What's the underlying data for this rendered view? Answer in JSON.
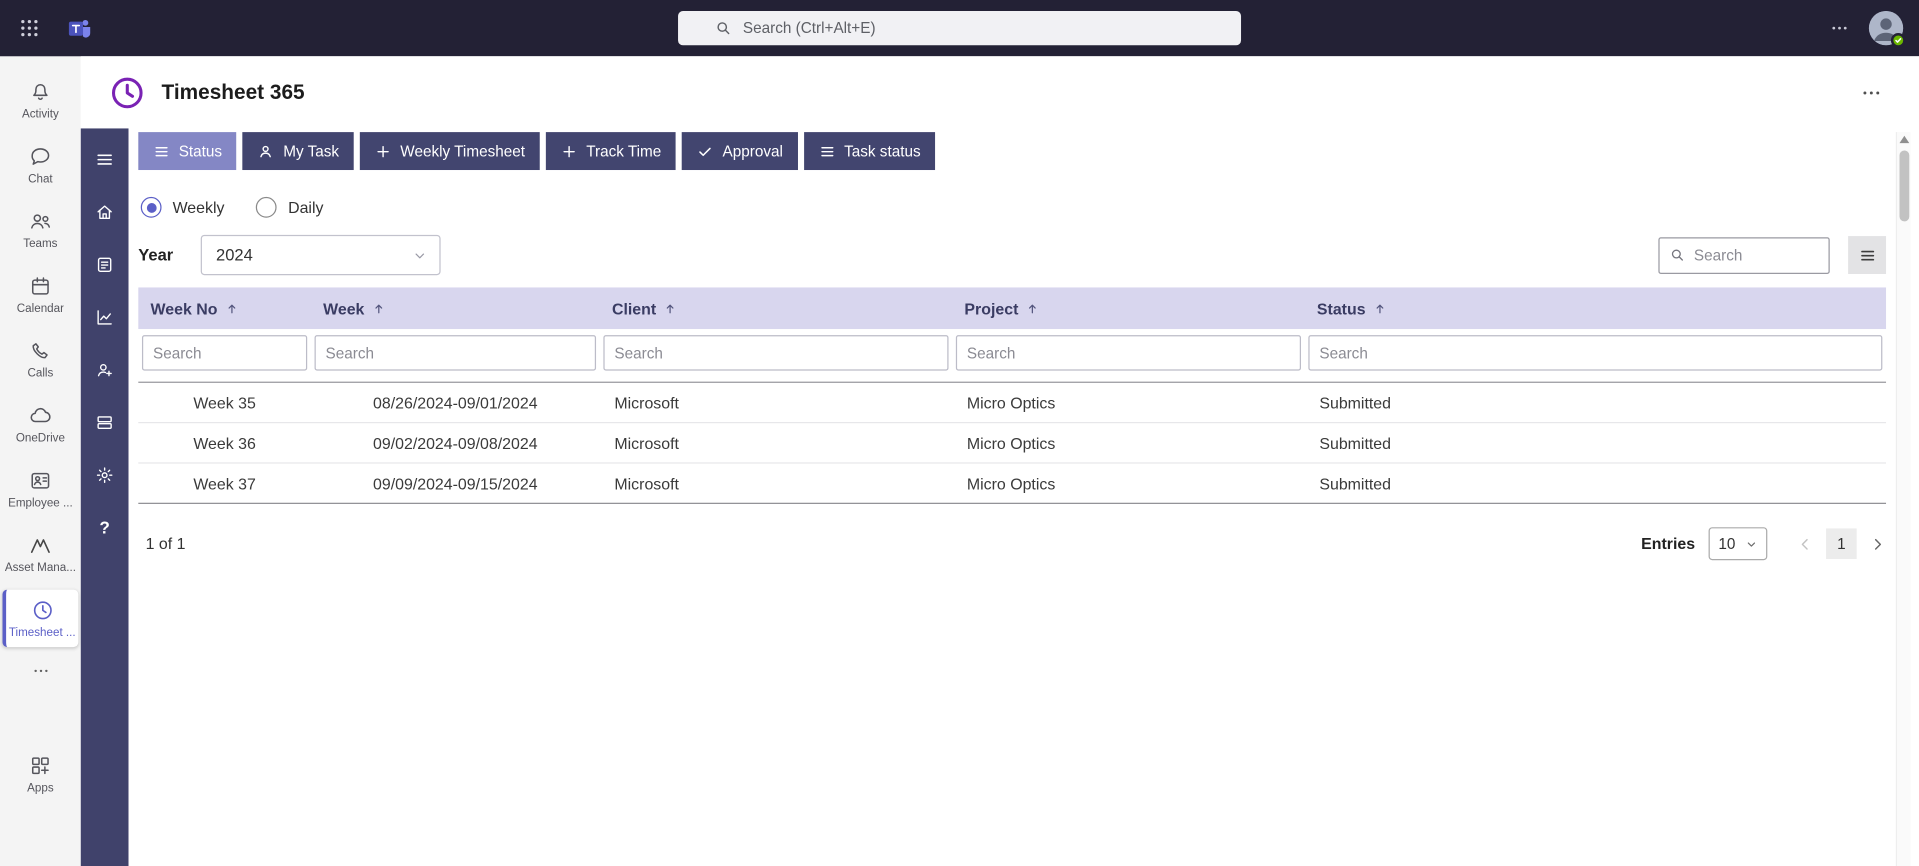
{
  "topbar": {
    "search": {
      "placeholder": "Search (Ctrl+Alt+E)"
    }
  },
  "rail": {
    "items": [
      {
        "label": "Activity"
      },
      {
        "label": "Chat"
      },
      {
        "label": "Teams"
      },
      {
        "label": "Calendar"
      },
      {
        "label": "Calls"
      },
      {
        "label": "OneDrive"
      },
      {
        "label": "Employee ..."
      },
      {
        "label": "Asset Mana..."
      },
      {
        "label": "Timesheet ..."
      }
    ],
    "apps_label": "Apps"
  },
  "app": {
    "title": "Timesheet 365"
  },
  "tabs": [
    {
      "label": "Status"
    },
    {
      "label": "My Task"
    },
    {
      "label": "Weekly Timesheet"
    },
    {
      "label": "Track Time"
    },
    {
      "label": "Approval"
    },
    {
      "label": "Task status"
    }
  ],
  "view_toggle": {
    "weekly": "Weekly",
    "daily": "Daily"
  },
  "filters": {
    "year_label": "Year",
    "year_value": "2024",
    "search_placeholder": "Search"
  },
  "table": {
    "columns": [
      "Week No",
      "Week",
      "Client",
      "Project",
      "Status"
    ],
    "filter_placeholder": "Search",
    "rows": [
      [
        "Week 35",
        "08/26/2024-09/01/2024",
        "Microsoft",
        "Micro Optics",
        "Submitted"
      ],
      [
        "Week 36",
        "09/02/2024-09/08/2024",
        "Microsoft",
        "Micro Optics",
        "Submitted"
      ],
      [
        "Week 37",
        "09/09/2024-09/15/2024",
        "Microsoft",
        "Micro Optics",
        "Submitted"
      ]
    ]
  },
  "footer": {
    "page_info": "1 of 1",
    "entries_label": "Entries",
    "entries_value": "10",
    "current_page": "1"
  },
  "colors": {
    "accent": "#5b5fc7",
    "tab_bg": "#42456f",
    "tab_selected_bg": "#8487c5",
    "table_header_bg": "#d8d6ee",
    "topbar_bg": "#232135",
    "status_available": "#6bb700"
  }
}
